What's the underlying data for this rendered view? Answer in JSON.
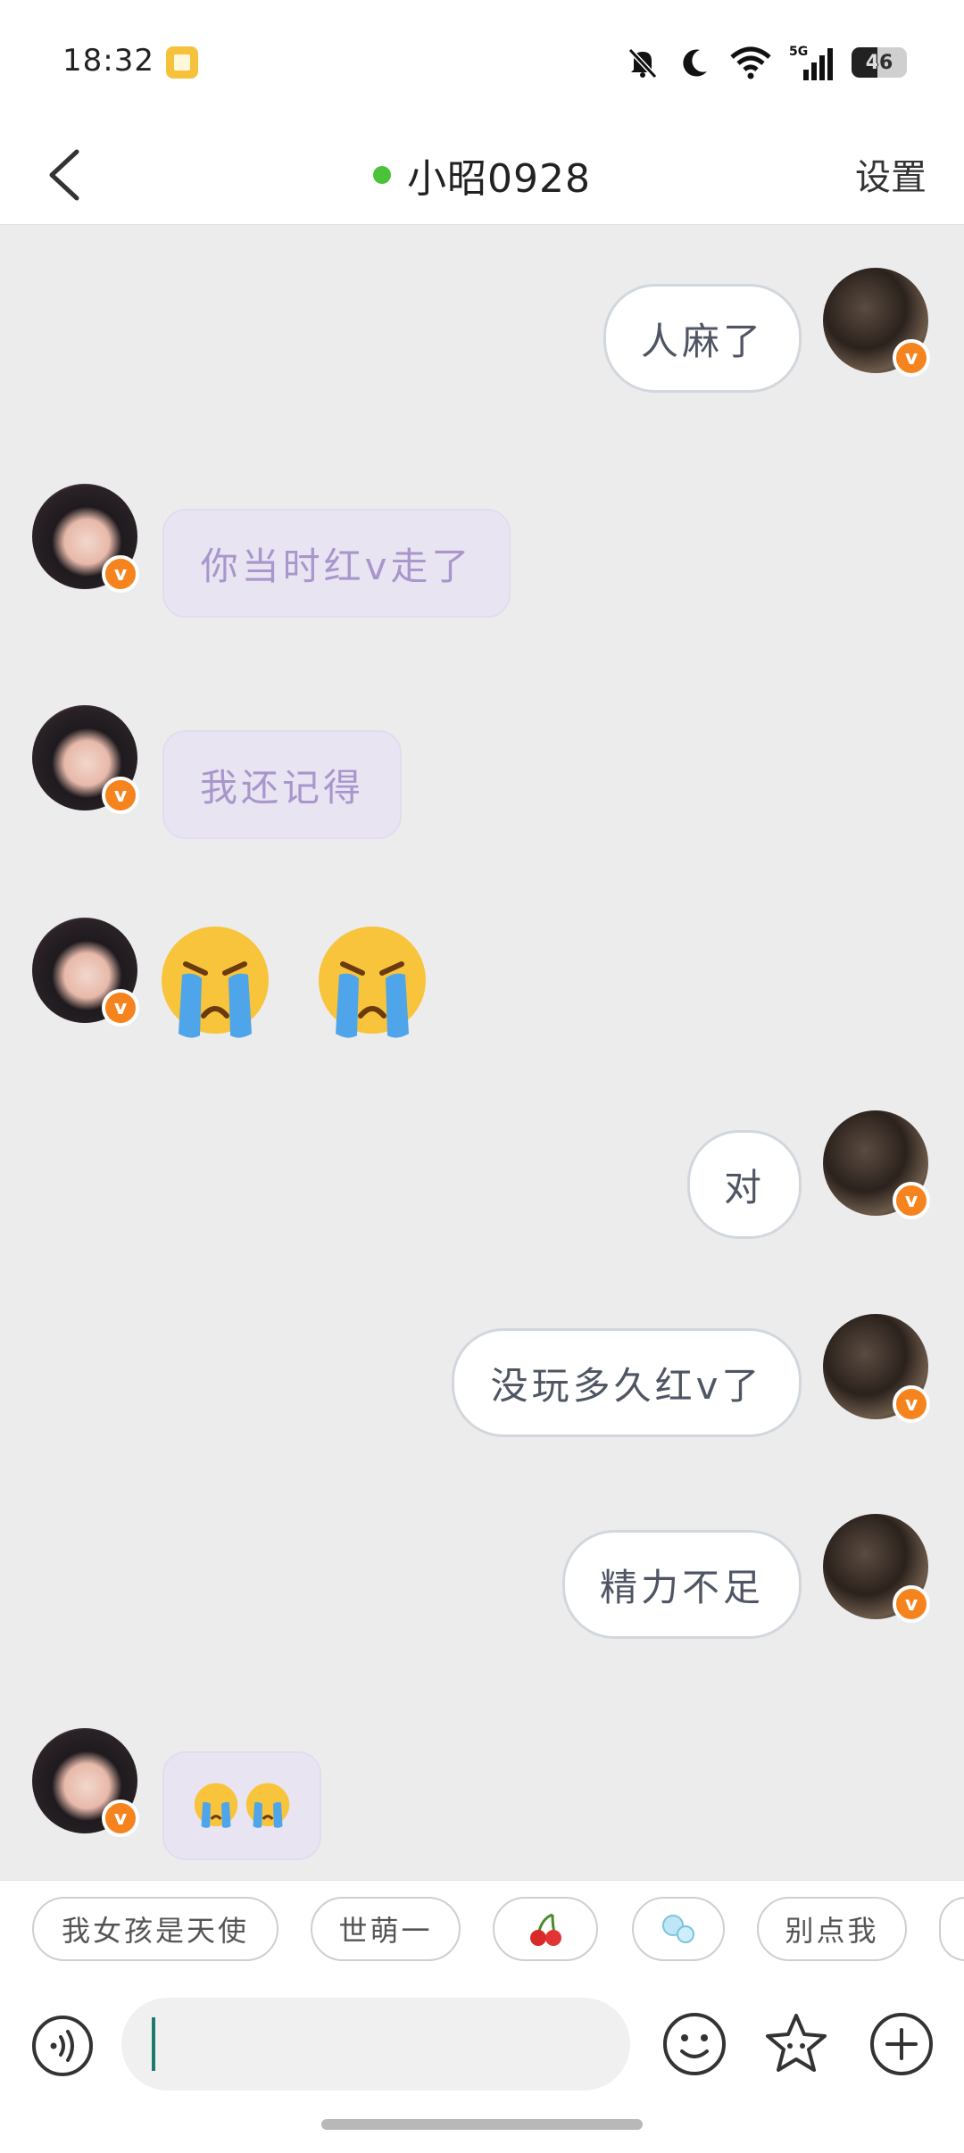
{
  "status_bar": {
    "time": "18:32",
    "network": "5G",
    "battery": "46",
    "battery_level_percent": 46
  },
  "header": {
    "title": "小昭0928",
    "settings_label": "设置",
    "online_color": "#4cc13a"
  },
  "badge_text": "v",
  "messages": [
    {
      "sender": "me",
      "text": "人麻了"
    },
    {
      "sender": "her",
      "text": "你当时红v走了"
    },
    {
      "sender": "her",
      "text": "我还记得"
    },
    {
      "sender": "her",
      "emoji": "loudly-crying-face",
      "count": 2
    },
    {
      "sender": "me",
      "text": "对"
    },
    {
      "sender": "me",
      "text": "没玩多久红v了"
    },
    {
      "sender": "me",
      "text": "精力不足"
    },
    {
      "sender": "her",
      "emoji": "loudly-crying-face",
      "count": 2
    }
  ],
  "quick_replies": [
    "我女孩是天使",
    "世萌一",
    "cherry-emoji",
    "bubbles-emoji",
    "别点我"
  ],
  "input": {
    "value": "",
    "placeholder": ""
  },
  "icons": {
    "back": "back-arrow-icon",
    "voice": "voice-input-icon",
    "emoji": "smiley-icon",
    "sticker": "star-sticker-icon",
    "more": "plus-icon"
  },
  "colors": {
    "my_bubble_border": "#d2d7de",
    "her_bubble_bg": "#e9e4f2",
    "her_text": "#a896cc",
    "badge": "#f5841f"
  }
}
